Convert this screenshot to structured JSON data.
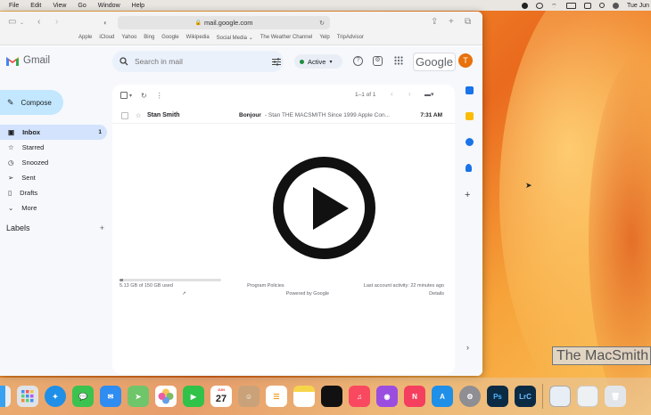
{
  "menubar": {
    "items": [
      "File",
      "Edit",
      "View",
      "Go",
      "Window",
      "Help"
    ],
    "clock": "Tue Jun"
  },
  "browser": {
    "url": "mail.google.com",
    "favorites": [
      "Apple",
      "iCloud",
      "Yahoo",
      "Bing",
      "Google",
      "Wikipedia",
      "Social Media ⌄",
      "The Weather Channel",
      "Yelp",
      "TripAdvisor"
    ]
  },
  "gmail": {
    "app_name": "Gmail",
    "search_placeholder": "Search in mail",
    "status": "Active",
    "brand": "Google",
    "avatar_letter": "T",
    "compose": "Compose",
    "nav": [
      {
        "label": "Inbox",
        "count": "1"
      },
      {
        "label": "Starred",
        "count": ""
      },
      {
        "label": "Snoozed",
        "count": ""
      },
      {
        "label": "Sent",
        "count": ""
      },
      {
        "label": "Drafts",
        "count": ""
      },
      {
        "label": "More",
        "count": ""
      }
    ],
    "labels_heading": "Labels",
    "pager": "1–1 of 1",
    "email": {
      "sender": "Stan Smith",
      "subject": "Bonjour",
      "snippet": "- Stan THE MACSMITH Since 1999 Apple Con...",
      "time": "7:31 AM"
    },
    "footer": {
      "storage": "5.13 GB of 150 GB used",
      "storage_fraction": 0.034,
      "policies": "Program Policies",
      "powered": "Powered by Google",
      "activity": "Last account activity: 22 minutes ago",
      "details": "Details"
    }
  },
  "watermark": "The MacSmith",
  "dock": {
    "calendar_month": "JUN",
    "calendar_day": "27",
    "apps": [
      "finder",
      "launchpad",
      "safari",
      "messages",
      "mail",
      "maps",
      "photos",
      "facetime",
      "calendar",
      "contacts",
      "reminders",
      "notes",
      "tv",
      "music",
      "podcasts",
      "news",
      "app-store",
      "system-settings",
      "photoshop",
      "lightroom"
    ]
  },
  "colors": {
    "accent": "#c2e7ff",
    "active_nav": "#d3e3fd",
    "avatar": "#e8710a",
    "status": "#1e8e3e"
  }
}
